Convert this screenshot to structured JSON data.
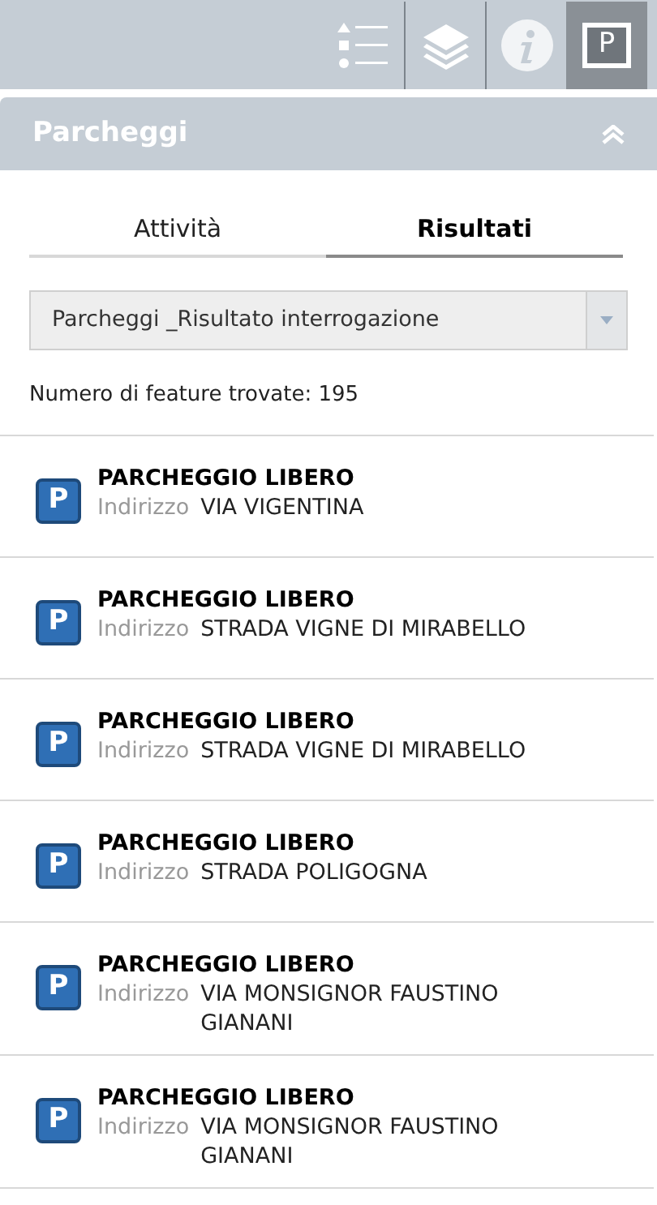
{
  "toolbar": {
    "tools": [
      {
        "kind": "legend",
        "selected": false
      },
      {
        "kind": "layers",
        "selected": false
      },
      {
        "kind": "info",
        "selected": false
      },
      {
        "kind": "parking",
        "selected": true,
        "label": "P"
      }
    ]
  },
  "panel": {
    "title": "Parcheggi"
  },
  "tabs": [
    {
      "label": "Attività",
      "selected": false
    },
    {
      "label": "Risultati",
      "selected": true
    }
  ],
  "layer_select": {
    "value": "Parcheggi _Risultato interrogazione"
  },
  "count": "Numero di feature trovate: 195",
  "results": [
    {
      "icon": "P",
      "title": "PARCHEGGIO LIBERO",
      "field": "Indirizzo",
      "value": "VIA VIGENTINA"
    },
    {
      "icon": "P",
      "title": "PARCHEGGIO LIBERO",
      "field": "Indirizzo",
      "value": "STRADA VIGNE DI MIRABELLO"
    },
    {
      "icon": "P",
      "title": "PARCHEGGIO LIBERO",
      "field": "Indirizzo",
      "value": "STRADA VIGNE DI MIRABELLO"
    },
    {
      "icon": "P",
      "title": "PARCHEGGIO LIBERO",
      "field": "Indirizzo",
      "value": "STRADA POLIGOGNA"
    },
    {
      "icon": "P",
      "title": "PARCHEGGIO LIBERO",
      "field": "Indirizzo",
      "value": "VIA MONSIGNOR FAUSTINO GIANANI"
    },
    {
      "icon": "P",
      "title": "PARCHEGGIO LIBERO",
      "field": "Indirizzo",
      "value": "VIA MONSIGNOR FAUSTINO GIANANI"
    }
  ]
}
